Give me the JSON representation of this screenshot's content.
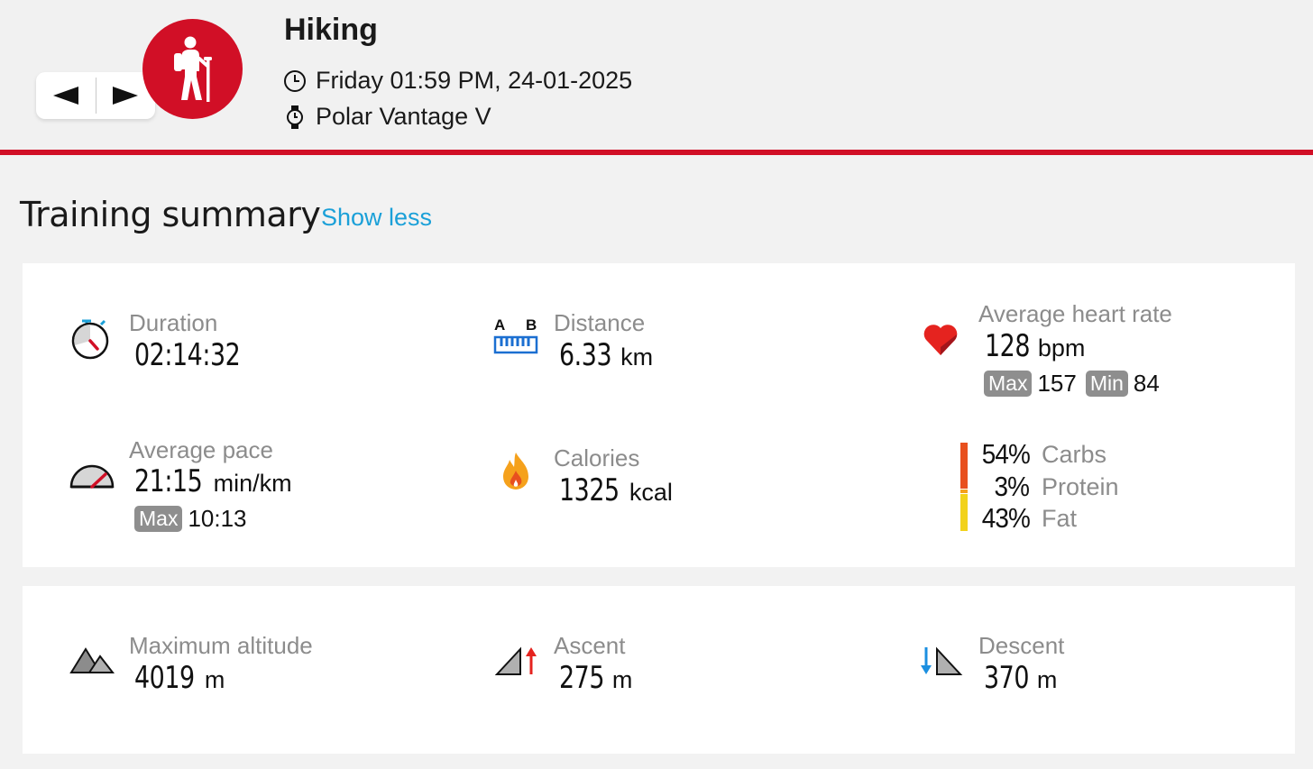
{
  "header": {
    "title": "Hiking",
    "date": "Friday 01:59 PM, 24-01-2025",
    "device": "Polar Vantage V",
    "prev_glyph": "◀",
    "next_glyph": "▶",
    "sport_icon": "hiker-icon",
    "accent_color": "#d10f26"
  },
  "summary": {
    "title": "Training summary",
    "toggle_label": "Show less"
  },
  "stats": {
    "duration": {
      "label": "Duration",
      "value": "02:14:32"
    },
    "distance": {
      "label": "Distance",
      "value": "6.33",
      "unit": "km",
      "icon_a": "A",
      "icon_b": "B"
    },
    "heart_rate": {
      "label": "Average heart rate",
      "value": "128",
      "unit": "bpm",
      "max_label": "Max",
      "max_value": "157",
      "min_label": "Min",
      "min_value": "84"
    },
    "pace": {
      "label": "Average pace",
      "value": "21:15",
      "unit": "min/km",
      "max_label": "Max",
      "max_value": "10:13"
    },
    "calories": {
      "label": "Calories",
      "value": "1325",
      "unit": "kcal"
    },
    "macros": [
      {
        "pct": "54%",
        "name": "Carbs",
        "color": "#e8501e"
      },
      {
        "pct": "3%",
        "name": "Protein",
        "color": "#f5a11c"
      },
      {
        "pct": "43%",
        "name": "Fat",
        "color": "#f2d21b"
      }
    ],
    "max_altitude": {
      "label": "Maximum altitude",
      "value": "4019",
      "unit": "m"
    },
    "ascent": {
      "label": "Ascent",
      "value": "275",
      "unit": "m"
    },
    "descent": {
      "label": "Descent",
      "value": "370",
      "unit": "m"
    }
  }
}
